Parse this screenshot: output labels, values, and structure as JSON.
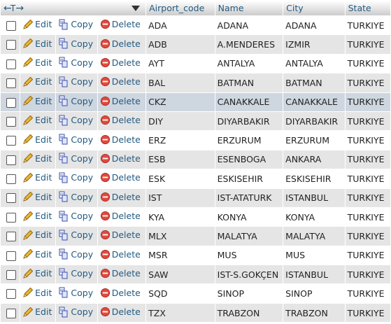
{
  "header": {
    "nav_left": "←",
    "nav_t": "T",
    "nav_right": "→",
    "columns": [
      "Airport_code",
      "Name",
      "City",
      "State"
    ]
  },
  "actions": {
    "edit": "Edit",
    "copy": "Copy",
    "delete": "Delete"
  },
  "colors": {
    "link": "#235a81",
    "row_alt": "#e5e5e5",
    "row_highlight": "#ced6df",
    "delete_icon": "#e04a3f"
  },
  "rows": [
    {
      "code": "ADA",
      "name": "ADANA",
      "city": "ADANA",
      "state": "TURKIYE"
    },
    {
      "code": "ADB",
      "name": "A.MENDERES",
      "city": "IZMIR",
      "state": "TURKIYE"
    },
    {
      "code": "AYT",
      "name": "ANTALYA",
      "city": "ANTALYA",
      "state": "TURKIYE"
    },
    {
      "code": "BAL",
      "name": "BATMAN",
      "city": "BATMAN",
      "state": "TURKIYE"
    },
    {
      "code": "CKZ",
      "name": "CANAKKALE",
      "city": "CANAKKALE",
      "state": "TURKIYE"
    },
    {
      "code": "DIY",
      "name": "DIYARBAKIR",
      "city": "DIYARBAKIR",
      "state": "TURKIYE"
    },
    {
      "code": "ERZ",
      "name": "ERZURUM",
      "city": "ERZURUM",
      "state": "TURKIYE"
    },
    {
      "code": "ESB",
      "name": "ESENBOGA",
      "city": "ANKARA",
      "state": "TURKIYE"
    },
    {
      "code": "ESK",
      "name": "ESKISEHIR",
      "city": "ESKISEHIR",
      "state": "TURKIYE"
    },
    {
      "code": "IST",
      "name": "IST-ATATURK",
      "city": "ISTANBUL",
      "state": "TURKIYE"
    },
    {
      "code": "KYA",
      "name": "KONYA",
      "city": "KONYA",
      "state": "TURKIYE"
    },
    {
      "code": "MLX",
      "name": "MALATYA",
      "city": "MALATYA",
      "state": "TURKIYE"
    },
    {
      "code": "MSR",
      "name": "MUS",
      "city": "MUS",
      "state": "TURKIYE"
    },
    {
      "code": "SAW",
      "name": "IST-S.GOKÇEN",
      "city": "ISTANBUL",
      "state": "TURKIYE"
    },
    {
      "code": "SQD",
      "name": "SINOP",
      "city": "SINOP",
      "state": "TURKIYE"
    },
    {
      "code": "TZX",
      "name": "TRABZON",
      "city": "TRABZON",
      "state": "TURKIYE"
    }
  ]
}
